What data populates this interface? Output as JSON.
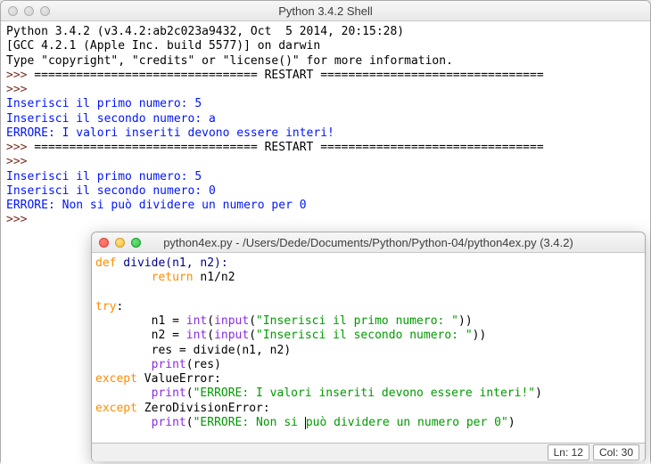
{
  "shell": {
    "title": "Python 3.4.2 Shell",
    "ver_line": "Python 3.4.2 (v3.4.2:ab2c023a9432, Oct  5 2014, 20:15:28)",
    "gcc_line": "[GCC 4.2.1 (Apple Inc. build 5577)] on darwin",
    "help_line": "Type \"copyright\", \"credits\" or \"license()\" for more information.",
    "prompt": ">>>",
    "restart1": " ================================ RESTART ================================",
    "input1a": "Inserisci il primo numero: 5",
    "input1b": "Inserisci il secondo numero: a",
    "err1": "ERRORE: I valori inseriti devono essere interi!",
    "restart2": " ================================ RESTART ================================",
    "input2a": "Inserisci il primo numero: 5",
    "input2b": "Inserisci il secondo numero: 0",
    "err2": "ERRORE: Non si può dividere un numero per 0",
    "space": " "
  },
  "editor": {
    "title": "python4ex.py - /Users/Dede/Documents/Python/Python-04/python4ex.py (3.4.2)",
    "status_ln_label": "Ln: 12",
    "status_col_label": "Col: 30",
    "code": {
      "kw_def": "def",
      "fn_divide": " divide(n1, n2):",
      "kw_return": "return",
      "ret_expr": " n1/n2",
      "kw_try": "try",
      "n1_lhs": "        n1 = ",
      "kw_int": "int",
      "open_p": "(",
      "kw_input": "input",
      "open_p2": "(",
      "str1": "\"Inserisci il primo numero: \"",
      "close_pp1": "))",
      "n2_lhs": "        n2 = ",
      "str2": "\"Inserisci il secondo numero: \"",
      "close_pp2": "))",
      "res_lhs": "        res = divide(n1, n2)",
      "print_open": "(",
      "kw_print": "print",
      "print_res_arg": "res)",
      "kw_except": "except",
      "exc_value": " ValueError:",
      "err_open": "(",
      "str_err1": "\"ERRORE: I valori inseriti devono essere interi!\"",
      "close_p": ")",
      "exc_zero": " ZeroDivisionError:",
      "str_err2_a": "\"ERRORE: Non si ",
      "str_err2_b": "può dividere un numero per 0\"",
      "colon": ":"
    }
  }
}
